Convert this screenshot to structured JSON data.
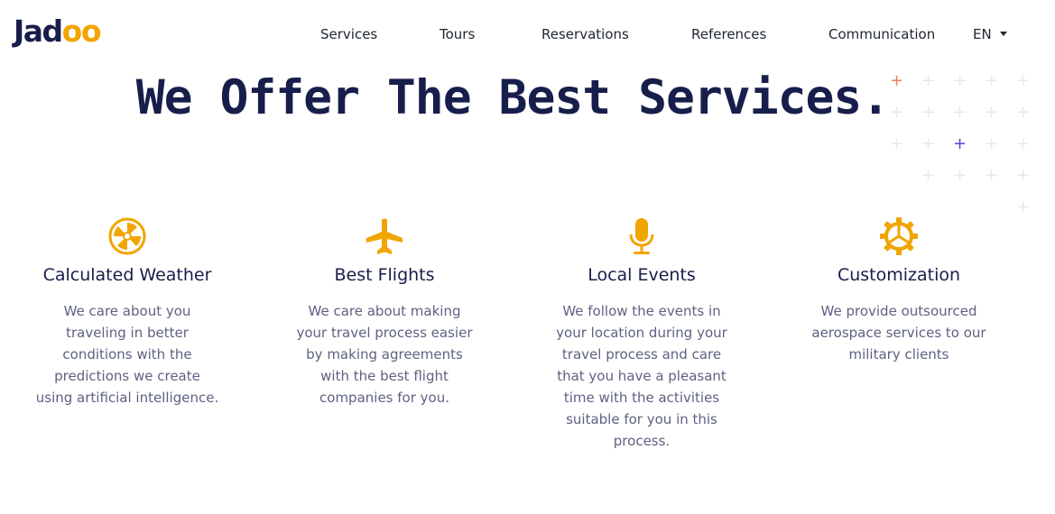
{
  "header": {
    "logo": {
      "main": "Jad",
      "accent": "oo"
    },
    "nav": [
      "Services",
      "Tours",
      "Reservations",
      "References",
      "Communication"
    ],
    "language": "EN"
  },
  "hero": {
    "title": "We Offer The Best Services."
  },
  "colors": {
    "brand": "#181e4b",
    "accent": "#f1a501",
    "text_muted": "#5e6282",
    "plus_default": "#e6e6ef",
    "plus_orange": "#f17d5b",
    "plus_purple": "#5b43d6"
  },
  "services": [
    {
      "icon": "weather-icon",
      "title": "Calculated Weather",
      "lines": [
        "We care about you",
        "traveling in better",
        "conditions with the",
        "predictions we create",
        "using artificial intelligence."
      ]
    },
    {
      "icon": "airplane-icon",
      "title": "Best Flights",
      "lines": [
        "We care about making",
        "your travel process easier",
        "by making agreements",
        "with the best flight",
        "companies for you."
      ]
    },
    {
      "icon": "microphone-icon",
      "title": "Local Events",
      "lines": [
        "We follow the events in",
        "your location during your",
        "travel process and care",
        "that you have a pleasant",
        "time with the activities",
        "suitable for you in this",
        "process."
      ]
    },
    {
      "icon": "gear-icon",
      "title": "Customization",
      "lines": [
        "We provide outsourced",
        "aerospace services to our",
        "military clients"
      ]
    }
  ]
}
